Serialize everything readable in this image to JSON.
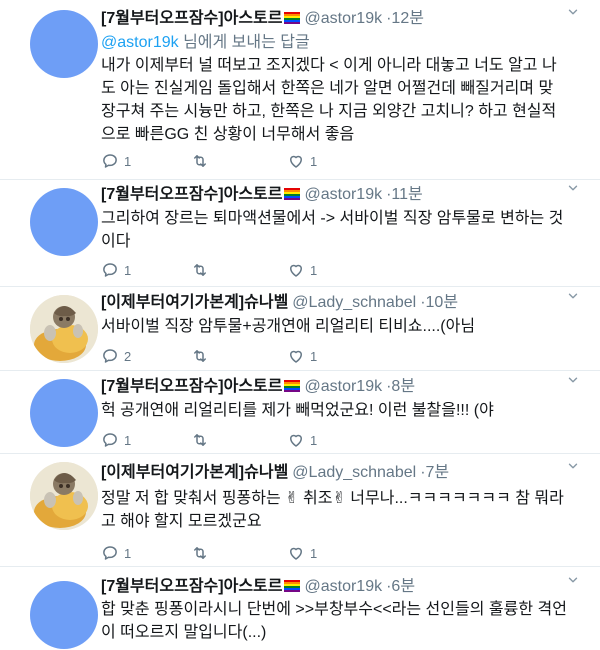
{
  "reply_prefix": "님에게 보내는 답글",
  "tweets": [
    {
      "name": "[7월부터오프잠수]아스토르",
      "handle": "@astor19k",
      "time": "12분",
      "reply_to": "@astor19k",
      "text": "내가 이제부터 널 떠보고 조지겠다 < 이게 아니라 대놓고 너도 알고 나도 아는 진실게임 돌입해서 한쪽은 네가 알면 어쩔건데 빼질거리며 맞장구쳐 주는 시늉만 하고, 한쪽은 나 지금 외양간 고치니? 하고 현실적으로 빠른GG 친 상황이 너무해서 좋음",
      "replies": "1",
      "retweets": "",
      "likes": "1"
    },
    {
      "name": "[7월부터오프잠수]아스토르",
      "handle": "@astor19k",
      "time": "11분",
      "text": "그리하여 장르는 퇴마액션물에서 -> 서바이벌 직장 암투물로 변하는 것이다",
      "replies": "1",
      "retweets": "",
      "likes": "1"
    },
    {
      "name": "[이제부터여기가본계]슈나벨",
      "handle": "@Lady_schnabel",
      "time": "10분",
      "text": "서바이벌 직장 암투물+공개연애 리얼리티 티비쇼....(아님",
      "replies": "2",
      "retweets": "",
      "likes": "1"
    },
    {
      "name": "[7월부터오프잠수]아스토르",
      "handle": "@astor19k",
      "time": "8분",
      "text": "헉 공개연애 리얼리티를 제가 빼먹었군요! 이런 불찰을!!! (야",
      "replies": "1",
      "retweets": "",
      "likes": "1"
    },
    {
      "name": "[이제부터여기가본계]슈나벨",
      "handle": "@Lady_schnabel",
      "time": "7분",
      "text": "정말 저 합 맞춰서 핑퐁하는 ✌ 취조✌ 너무나...ㅋㅋㅋㅋㅋㅋㅋ 참 뭐라고 해야 할지 모르겠군요",
      "replies": "1",
      "retweets": "",
      "likes": "1"
    },
    {
      "name": "[7월부터오프잠수]아스토르",
      "handle": "@astor19k",
      "time": "6분",
      "text": "합 맞춘 핑퐁이라시니 단번에 >>부창부수<<라는 선인들의 훌륭한 격언이 떠오르지 말입니다(...)",
      "replies": "",
      "retweets": "",
      "likes": ""
    }
  ]
}
